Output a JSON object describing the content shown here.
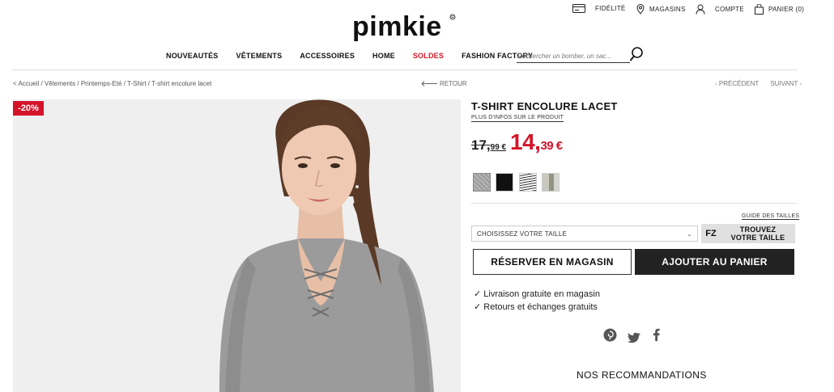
{
  "header": {
    "logo_text": "pimkie",
    "utility": {
      "fidelite": "FIDÉLITÉ",
      "magasins": "MAGASINS",
      "compte": "COMPTE",
      "panier": "PANIER (0)"
    },
    "nav": [
      "NOUVEAUTÉS",
      "VÊTEMENTS",
      "ACCESSOIRES",
      "HOME",
      "SOLDES",
      "FASHION FACTORY"
    ],
    "search_placeholder": "Rechercher un bomber, un sac..."
  },
  "breadcrumb": {
    "text": "< Accueil / Vêtements / Printemps-Eté / T-Shirt / T-shirt encolure lacet",
    "retour": "RETOUR",
    "precedent": "PRÉCÉDENT",
    "suivant": "SUIVANT"
  },
  "product": {
    "discount_badge": "-20%",
    "title": "T-SHIRT ENCOLURE LACET",
    "more_info": "PLUS D'INFOS SUR LE PRODUIT",
    "old_price_int": "17,",
    "old_price_dec": "99 €",
    "new_price_int": "14,",
    "new_price_dec": "39 €",
    "swatch_colors": [
      "grey-marl",
      "black",
      "black-white-stripe",
      "khaki"
    ],
    "size_guide": "GUIDE DES TAILLES",
    "size_select_placeholder": "CHOISISSEZ VOTRE TAILLE",
    "fz_logo": "fz",
    "fz_line1": "TROUVEZ",
    "fz_line2": "VOTRE TAILLE",
    "reserve_button": "RÉSERVER EN MAGASIN",
    "cart_button": "AJOUTER AU PANIER",
    "perks": [
      "✓ Livraison gratuite en magasin",
      "✓ Retours et échanges gratuits"
    ],
    "recommendations_title": "NOS RECOMMANDATIONS"
  },
  "colors": {
    "accent_red": "#d4142a",
    "cart_button_bg": "#222222"
  }
}
